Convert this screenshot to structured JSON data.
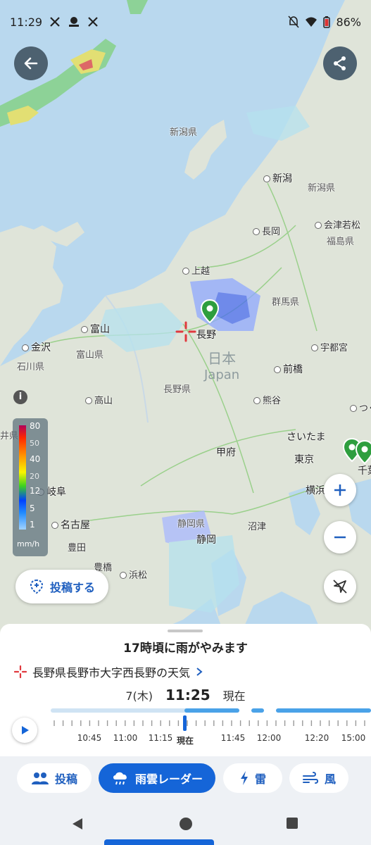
{
  "status_bar": {
    "time": "11:29",
    "left_icons": [
      "x-icon",
      "aeon-icon",
      "x-icon"
    ],
    "battery": "86%"
  },
  "map": {
    "country": "日本",
    "country_en": "Japan",
    "labels": {
      "niigata_pref_sea": "新潟県",
      "niigata": "新潟",
      "niigata_pref": "新潟県",
      "aizu": "会津若松",
      "nagaoka": "長岡",
      "fukushima_pref": "福島県",
      "joetsu": "上越",
      "gunma_pref": "群馬県",
      "toyama": "富山",
      "nagano": "長野",
      "kanazawa": "金沢",
      "toyama_pref": "富山県",
      "ishikawa_pref": "石川県",
      "utsunomiya": "宇都宮",
      "maebashi": "前橋",
      "takayama": "高山",
      "nagano_pref": "長野県",
      "kumagaya": "熊谷",
      "tsukuba": "つくば",
      "fukui_pref": "井県",
      "saitama": "さいたま",
      "kofu": "甲府",
      "tokyo": "東京",
      "chiba": "千葉",
      "gifu": "岐阜",
      "yokohama": "横浜",
      "nagoya": "名古屋",
      "shizuoka_pref": "静岡県",
      "numazu": "沼津",
      "toyota": "豊田",
      "shizuoka": "静岡",
      "toyohashi": "豊橋",
      "hamamatsu": "浜松"
    }
  },
  "legend": {
    "levels": [
      "80",
      "50",
      "40",
      "20",
      "12",
      "5",
      "1"
    ],
    "unit": "mm/h"
  },
  "post_button": "投稿する",
  "sheet": {
    "headline": "17時頃に雨がやみます",
    "place": "長野県長野市大字西長野の天気",
    "date": "7(木)",
    "current_time": "11:25",
    "current_label": "現在",
    "timeline_labels": [
      "10:45",
      "11:00",
      "11:15",
      "現在",
      "11:45",
      "12:00",
      "12:20",
      "15:00"
    ]
  },
  "tabs": [
    {
      "label": "投稿",
      "icon": "people-icon"
    },
    {
      "label": "雨雲レーダー",
      "icon": "rain-cloud-icon",
      "active": true
    },
    {
      "label": "雷",
      "icon": "lightning-icon"
    },
    {
      "label": "風",
      "icon": "wind-icon"
    }
  ],
  "colors": {
    "accent": "#1565d8",
    "sea": "#b9d8ee",
    "land": "#dfe4d9"
  }
}
